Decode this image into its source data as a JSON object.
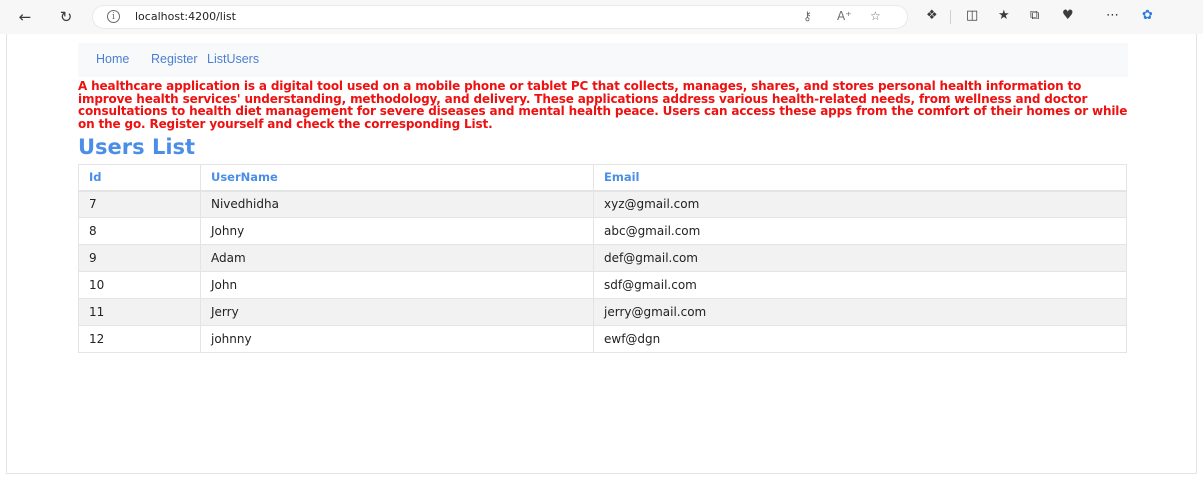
{
  "browser": {
    "url": "localhost:4200/list"
  },
  "nav": {
    "links": [
      "Home",
      "Register",
      "ListUsers"
    ]
  },
  "description": "A healthcare application is a digital tool used on a mobile phone or tablet PC that collects, manages, shares, and stores personal health information to improve health services' understanding, methodology, and delivery. These applications address various health-related needs, from wellness and doctor consultations to health diet management for severe diseases and mental health peace. Users can access these apps from the comfort of their homes or while on the go. Register yourself and check the corresponding List.",
  "heading": "Users List",
  "table": {
    "headers": [
      "Id",
      "UserName",
      "Email"
    ],
    "rows": [
      [
        "7",
        "Nivedhidha",
        "xyz@gmail.com"
      ],
      [
        "8",
        "Johny",
        "abc@gmail.com"
      ],
      [
        "9",
        "Adam",
        "def@gmail.com"
      ],
      [
        "10",
        "John",
        "sdf@gmail.com"
      ],
      [
        "11",
        "Jerry",
        "jerry@gmail.com"
      ],
      [
        "12",
        "johnny",
        "ewf@dgn"
      ]
    ]
  },
  "colors": {
    "accent": "#4b8ee8",
    "description": "#ee1111",
    "stripe": "#f2f2f2"
  }
}
